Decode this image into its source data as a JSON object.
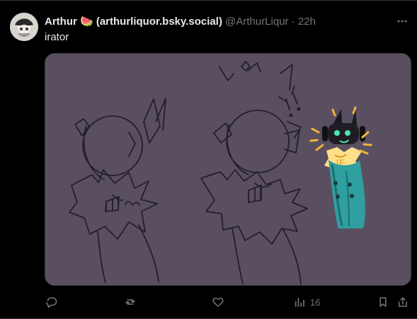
{
  "tweet": {
    "display_name": "Arthur 🍉 (arthurliquor.bsky.social)",
    "handle": "@ArthurLiqur",
    "separator": "·",
    "time": "22h",
    "text": "irator",
    "image_text": "JE"
  },
  "actions": {
    "views_count": "16"
  },
  "icons": {
    "more": "more-horizontal-icon",
    "reply": "reply-icon",
    "retweet": "retweet-icon",
    "like": "heart-icon",
    "views": "views-chart-icon",
    "bookmark": "bookmark-icon",
    "share": "share-icon"
  },
  "colors": {
    "background": "#000000",
    "image_background": "#5a4f61",
    "muted_text": "#71767b",
    "main_text": "#e7e9ea",
    "accent_yellow": "#f2b53b",
    "robe_teal": "#2f9f9f"
  }
}
